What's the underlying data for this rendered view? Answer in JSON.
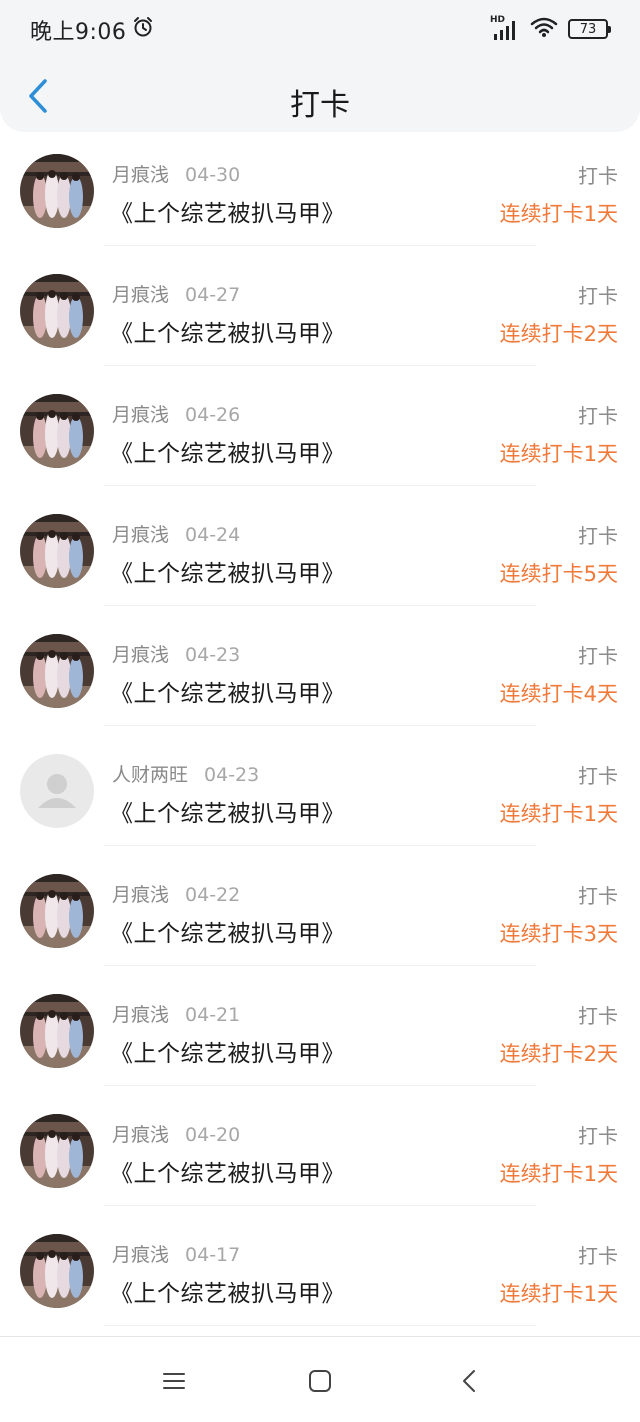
{
  "status": {
    "time": "晚上9:06",
    "battery": "73",
    "network": "HD"
  },
  "nav": {
    "title": "打卡"
  },
  "colors": {
    "accent": "#f07a3a",
    "back": "#2d8ed8",
    "muted": "#8a8a8a"
  },
  "items": [
    {
      "user": "月痕浅",
      "date": "04-30",
      "book": "《上个综艺被扒马甲》",
      "action": "打卡",
      "streak": "连续打卡1天",
      "avatar": "group-photo"
    },
    {
      "user": "月痕浅",
      "date": "04-27",
      "book": "《上个综艺被扒马甲》",
      "action": "打卡",
      "streak": "连续打卡2天",
      "avatar": "group-photo"
    },
    {
      "user": "月痕浅",
      "date": "04-26",
      "book": "《上个综艺被扒马甲》",
      "action": "打卡",
      "streak": "连续打卡1天",
      "avatar": "group-photo"
    },
    {
      "user": "月痕浅",
      "date": "04-24",
      "book": "《上个综艺被扒马甲》",
      "action": "打卡",
      "streak": "连续打卡5天",
      "avatar": "group-photo"
    },
    {
      "user": "月痕浅",
      "date": "04-23",
      "book": "《上个综艺被扒马甲》",
      "action": "打卡",
      "streak": "连续打卡4天",
      "avatar": "group-photo"
    },
    {
      "user": "人财两旺",
      "date": "04-23",
      "book": "《上个综艺被扒马甲》",
      "action": "打卡",
      "streak": "连续打卡1天",
      "avatar": "default-person"
    },
    {
      "user": "月痕浅",
      "date": "04-22",
      "book": "《上个综艺被扒马甲》",
      "action": "打卡",
      "streak": "连续打卡3天",
      "avatar": "group-photo"
    },
    {
      "user": "月痕浅",
      "date": "04-21",
      "book": "《上个综艺被扒马甲》",
      "action": "打卡",
      "streak": "连续打卡2天",
      "avatar": "group-photo"
    },
    {
      "user": "月痕浅",
      "date": "04-20",
      "book": "《上个综艺被扒马甲》",
      "action": "打卡",
      "streak": "连续打卡1天",
      "avatar": "group-photo"
    },
    {
      "user": "月痕浅",
      "date": "04-17",
      "book": "《上个综艺被扒马甲》",
      "action": "打卡",
      "streak": "连续打卡1天",
      "avatar": "group-photo"
    }
  ],
  "system_nav": {
    "menu": "menu-icon",
    "home": "home-icon",
    "back": "back-icon"
  }
}
